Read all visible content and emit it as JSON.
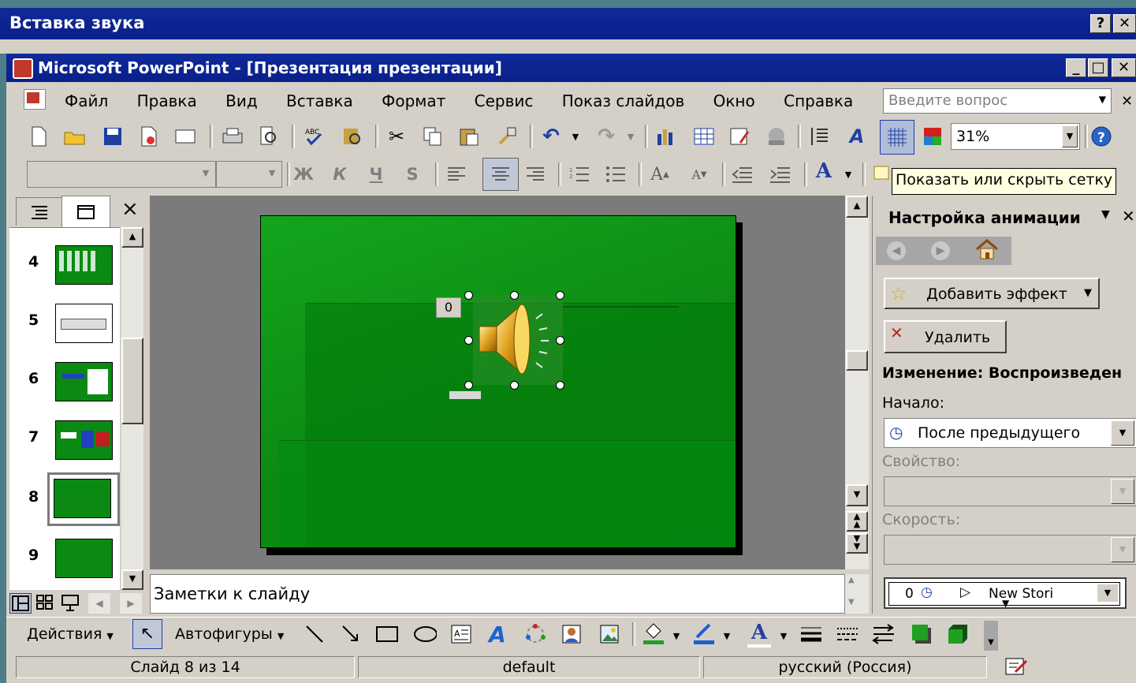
{
  "dialog": {
    "title": "Вставка звука",
    "help_btn": "?",
    "close_btn": "✕"
  },
  "app": {
    "title": "Microsoft PowerPoint - [Презентация презентации]",
    "min": "_",
    "max": "□",
    "close": "✕"
  },
  "menu": {
    "items": [
      "Файл",
      "Правка",
      "Вид",
      "Вставка",
      "Формат",
      "Сервис",
      "Показ слайдов",
      "Окно",
      "Справка"
    ],
    "help_placeholder": "Введите вопрос"
  },
  "toolbar": {
    "zoom": "31%"
  },
  "formatting": {
    "bold": "Ж",
    "italic": "К",
    "underline": "Ч",
    "shadow": "S",
    "font_color_glyph": "A"
  },
  "tooltip": "Показать или скрыть сетку",
  "slides_panel": {
    "close": "×",
    "slides": [
      "4",
      "5",
      "6",
      "7",
      "8",
      "9"
    ],
    "selected": "8"
  },
  "slide": {
    "sound_tag": "0"
  },
  "notes": {
    "placeholder": "Заметки к слайду"
  },
  "task_pane": {
    "title": "Настройка анимации",
    "add_effect": "Добавить эффект",
    "delete": "Удалить",
    "change_label": "Изменение: Воспроизведен",
    "start_label": "Начало:",
    "start_value": "После предыдущего",
    "property_label": "Свойство:",
    "speed_label": "Скорость:",
    "list_item_num": "0",
    "list_item_name": "New Stori"
  },
  "drawing": {
    "actions": "Действия",
    "autoshapes": "Автофигуры"
  },
  "statusbar": {
    "slide": "Слайд 8 из 14",
    "design": "default",
    "language": "русский (Россия)"
  },
  "colors": {
    "titlebar": "#0a1f8a",
    "slide_green": "#0a8a12",
    "chrome": "#d4d0c8",
    "workspace": "#7b7b7b"
  }
}
